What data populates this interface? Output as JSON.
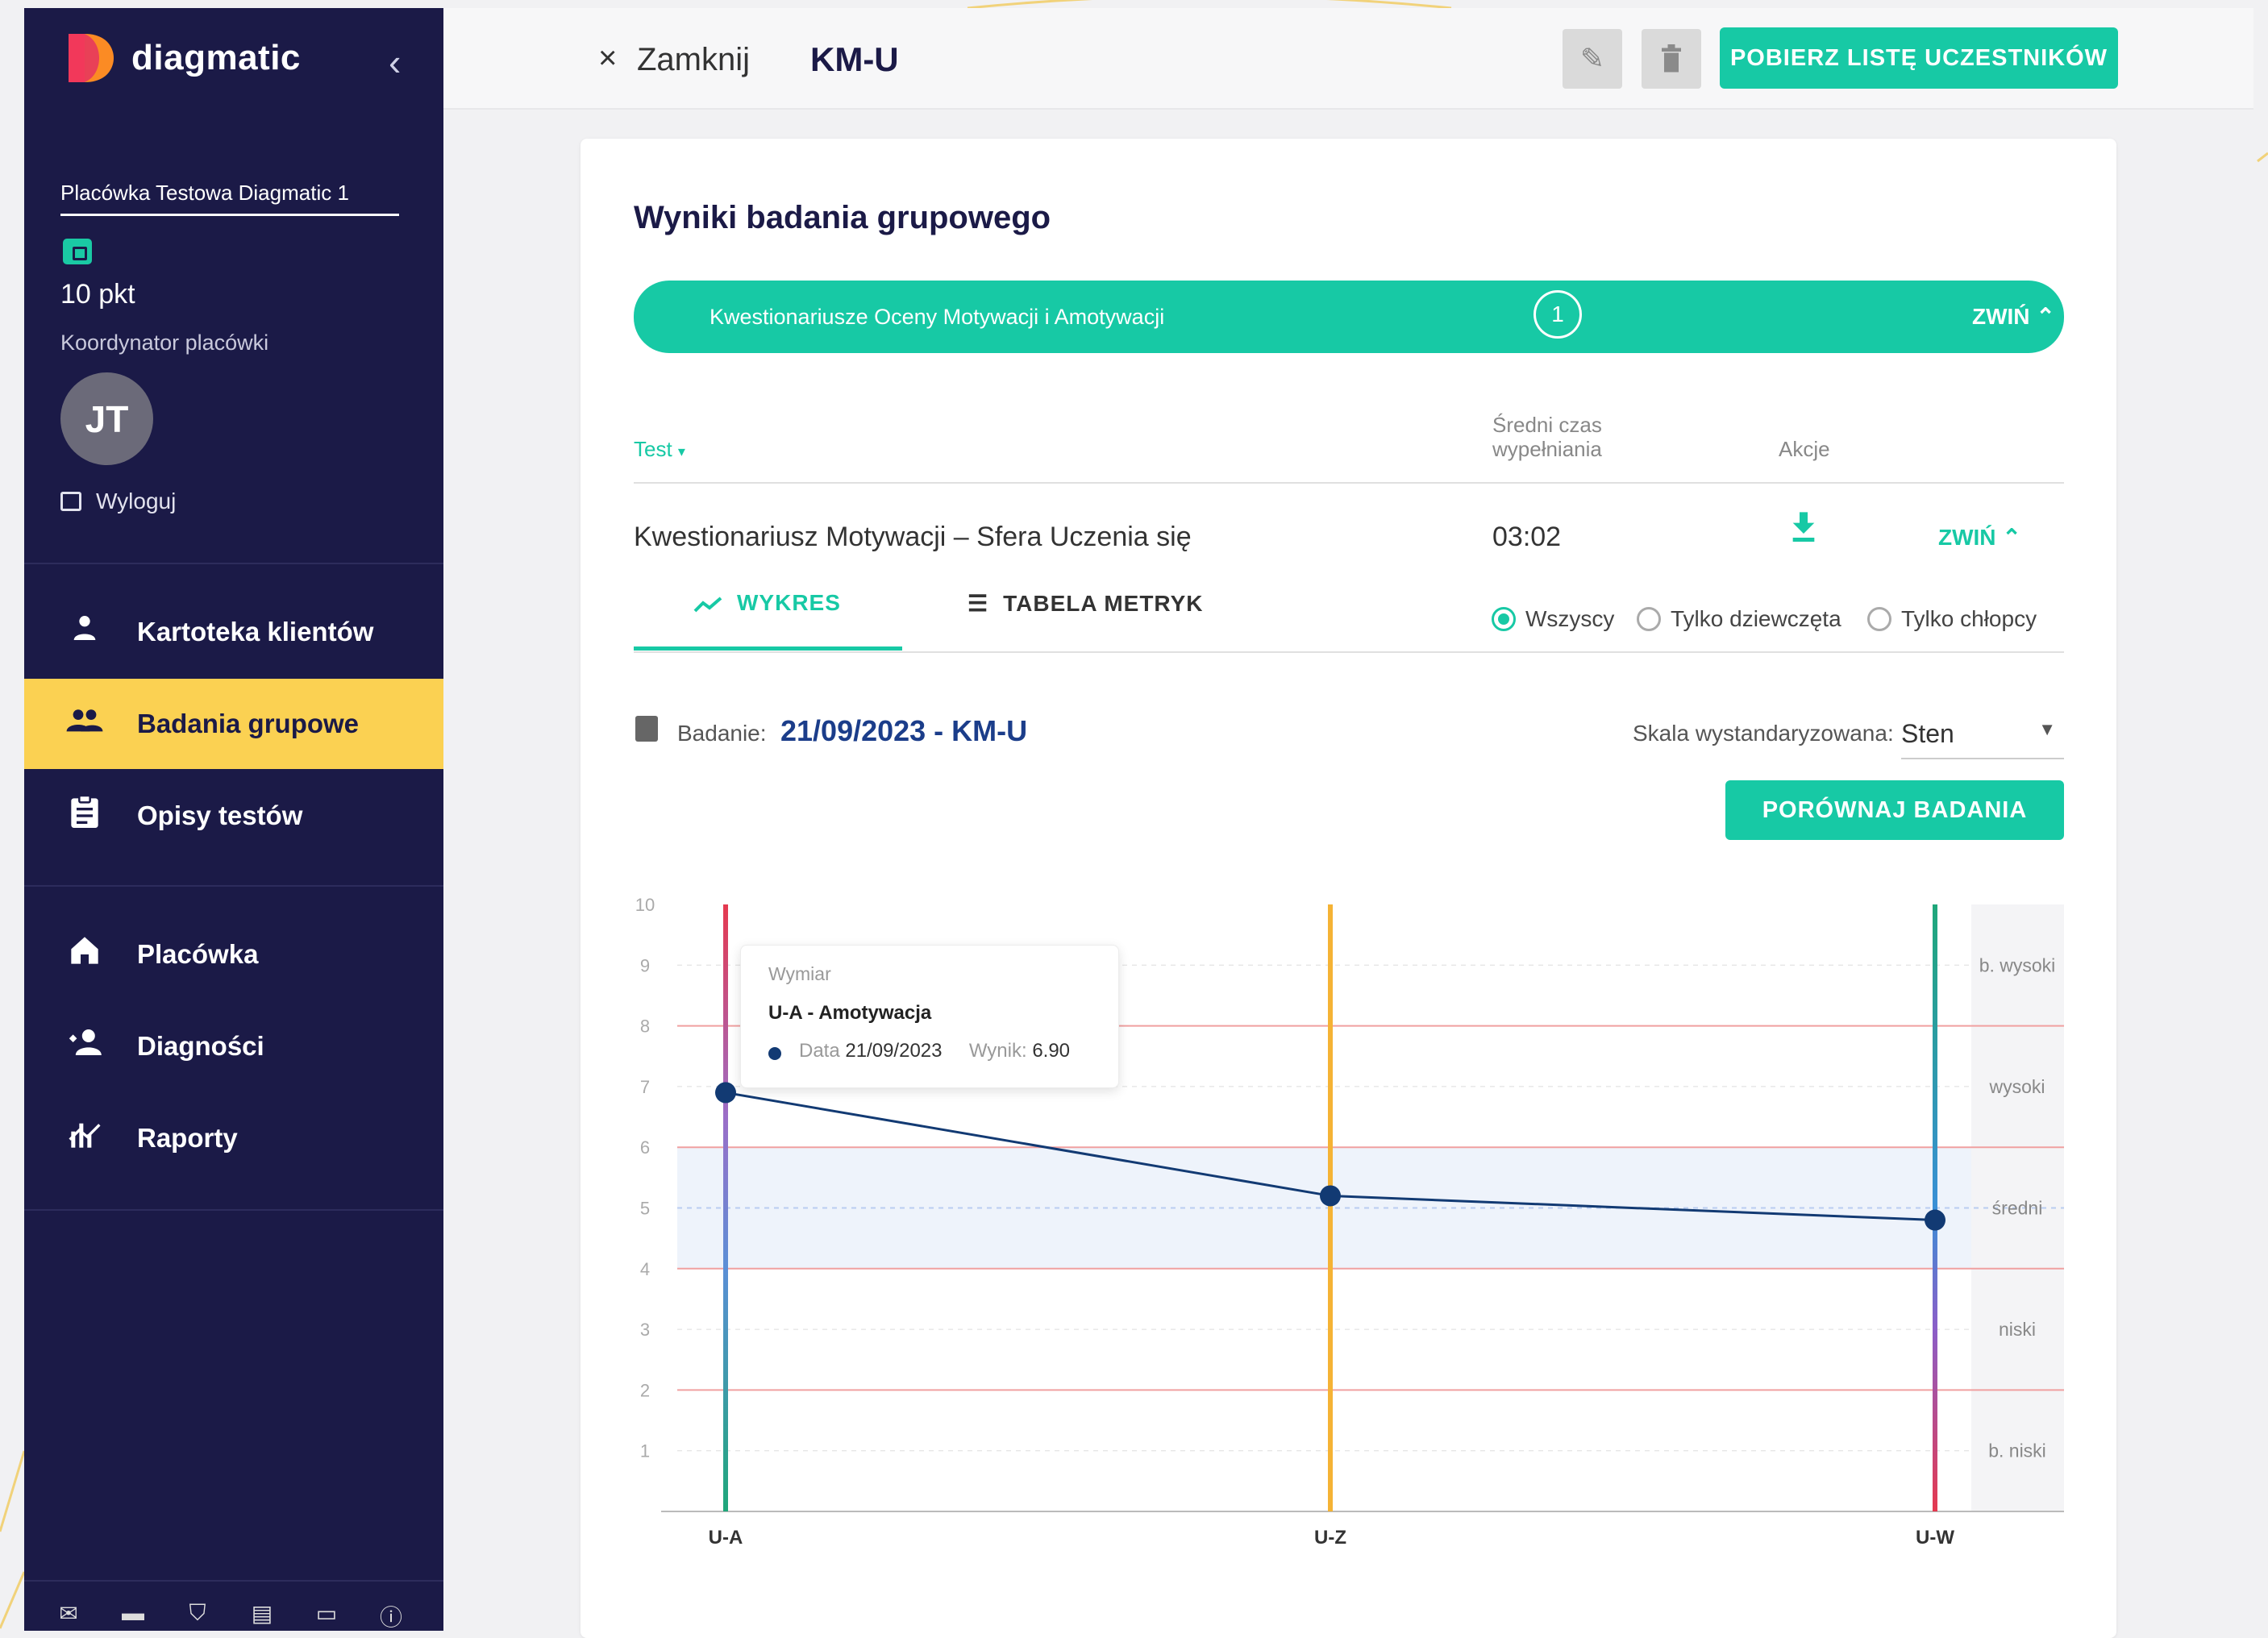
{
  "brand": {
    "name": "diagmatic"
  },
  "sidebar": {
    "facility": "Placówka Testowa Diagmatic 1",
    "points": "10 pkt",
    "role": "Koordynator placówki",
    "avatar_initials": "JT",
    "logout": "Wyloguj",
    "nav": [
      {
        "label": "Kartoteka klientów",
        "icon": "person-icon"
      },
      {
        "label": "Badania grupowe",
        "icon": "group-icon",
        "active": true
      },
      {
        "label": "Opisy testów",
        "icon": "clipboard-icon"
      },
      {
        "label": "Placówka",
        "icon": "home-icon"
      },
      {
        "label": "Diagności",
        "icon": "diagnosticians-icon"
      },
      {
        "label": "Raporty",
        "icon": "reports-icon"
      }
    ],
    "footer_icons": [
      "mail-icon",
      "clapperboard-icon",
      "shield-icon",
      "document-icon",
      "news-icon",
      "info-icon"
    ]
  },
  "topbar": {
    "close_label": "Zamknij",
    "title": "KM-U",
    "download_button": "POBIERZ LISTĘ UCZESTNIKÓW"
  },
  "card": {
    "title": "Wyniki badania grupowego",
    "group_bar": {
      "label": "Kwestionariusze Oceny Motywacji i Amotywacji",
      "count": "1",
      "collapse": "ZWIŃ"
    },
    "table": {
      "headers": {
        "test": "Test",
        "avg_time": [
          "Średni czas",
          "wypełniania"
        ],
        "actions": "Akcje"
      },
      "row": {
        "name": "Kwestionariusz Motywacji – Sfera Uczenia się",
        "time": "03:02",
        "collapse": "ZWIŃ"
      }
    },
    "tabs": [
      {
        "label": "WYKRES",
        "active": true
      },
      {
        "label": "TABELA METRYK",
        "active": false
      }
    ],
    "filters": [
      {
        "label": "Wszyscy",
        "checked": true
      },
      {
        "label": "Tylko dziewczęta",
        "checked": false
      },
      {
        "label": "Tylko chłopcy",
        "checked": false
      }
    ],
    "exam": {
      "label": "Badanie:",
      "value": "21/09/2023 - KM-U"
    },
    "scale": {
      "label": "Skala wystandaryzowana:",
      "value": "Sten"
    },
    "compare_button": "PORÓWNAJ BADANIA",
    "tooltip": {
      "header": "Wymiar",
      "dimension": "U-A - Amotywacja",
      "date_label": "Data",
      "date": "21/09/2023",
      "score_label": "Wynik:",
      "score": "6.90"
    }
  },
  "chart_data": {
    "type": "line",
    "categories": [
      "U-A",
      "U-Z",
      "U-W"
    ],
    "series": [
      {
        "values": [
          6.9,
          5.2,
          4.8
        ]
      }
    ],
    "ylim": [
      0,
      10
    ],
    "yticks": [
      1,
      2,
      3,
      4,
      5,
      6,
      7,
      8,
      9,
      10
    ],
    "bands": [
      {
        "label": "b. niski",
        "from": 0,
        "to": 2
      },
      {
        "label": "niski",
        "from": 2,
        "to": 4
      },
      {
        "label": "średni",
        "from": 4,
        "to": 6
      },
      {
        "label": "wysoki",
        "from": 6,
        "to": 8
      },
      {
        "label": "b. wysoki",
        "from": 8,
        "to": 10
      }
    ],
    "colors": {
      "line": "#123a73",
      "band_mid": "#eef3fb",
      "band_line": "#f0a0a0",
      "uz_axis": "#f5b335"
    }
  }
}
